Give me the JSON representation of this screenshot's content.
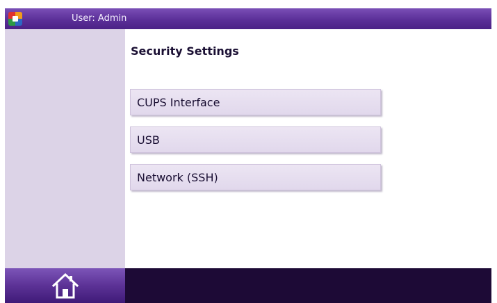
{
  "header": {
    "user_label": "User: Admin",
    "logo_icon": "app-logo-icon"
  },
  "page": {
    "title": "Security Settings"
  },
  "menu": {
    "items": [
      {
        "label": "CUPS Interface"
      },
      {
        "label": "USB"
      },
      {
        "label": "Network (SSH)"
      }
    ]
  },
  "footer": {
    "home_icon": "home-icon"
  },
  "colors": {
    "header_purple": "#5b2f98",
    "sidebar": "#dcd3e7",
    "button_face": "#e5dcee",
    "footer_dark": "#1d0a36"
  }
}
